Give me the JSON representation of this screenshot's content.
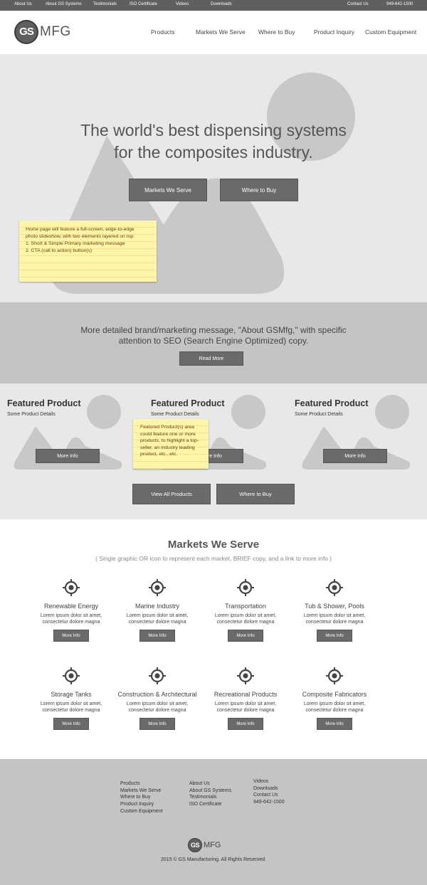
{
  "topbar": {
    "links": [
      "About Us",
      "About GS Systems",
      "Testimonials",
      "ISO Certificate",
      "Videos",
      "Downloads"
    ],
    "contact": "Contact Us",
    "phone": "949-642-1500"
  },
  "header": {
    "logo_mark": "GS",
    "logo_text": "MFG",
    "nav": [
      "Products",
      "Markets We Serve",
      "Where to Buy",
      "Product Inquiry",
      "Custom Equipment"
    ]
  },
  "hero": {
    "title_line1": "The world's best dispensing systems",
    "title_line2": "for the composites industry.",
    "cta_primary": "Markets We Serve",
    "cta_secondary": "Where to Buy",
    "note": [
      "Home page will feature a full-screen, edge-to-edge",
      "photo slideshow, with two elements layered on top:",
      "1. Short & Simple Primary marketing message",
      "2. CTA (call to action) button(s)"
    ]
  },
  "brand": {
    "line1": "More detailed brand/marketing message, \"About GSMfg,\" with specific",
    "line2": "attention to SEO (Search Engine Optimized) copy.",
    "button": "Read More"
  },
  "featured": {
    "items": [
      {
        "title": "Featured Product",
        "details": "Some Product Details",
        "button": "More Info"
      },
      {
        "title": "Featured Product",
        "details": "Some Product Details",
        "button": "More Info"
      },
      {
        "title": "Featured Product",
        "details": "Some Product Details",
        "button": "More Info"
      }
    ],
    "note": [
      "Featured Product(s) area",
      "could feature one or more",
      "products, to highlight a top-",
      "seller, an industry leading",
      "product, etc., etc."
    ],
    "view_all": "View All Products",
    "where_to_buy": "Where to Buy"
  },
  "markets": {
    "title": "Markets We Serve",
    "subtitle": "( Single graphic OR icon to represent each market, BRIEF copy, and a link to more info )",
    "items": [
      {
        "name": "Renewable Energy",
        "desc1": "Lorem ipsum dolor sit amet,",
        "desc2": "consectetur dolore magna",
        "button": "More Info",
        "icon": "crosshair-icon"
      },
      {
        "name": "Marine Industry",
        "desc1": "Lorem ipsum dolor sit amet,",
        "desc2": "consectetur dolore magna",
        "button": "More Info",
        "icon": "crosshair-icon"
      },
      {
        "name": "Transportation",
        "desc1": "Lorem ipsum dolor sit amet,",
        "desc2": "consectetur dolore magna",
        "button": "More Info",
        "icon": "crosshair-icon"
      },
      {
        "name": "Tub & Shower, Pools",
        "desc1": "Lorem ipsum dolor sit amet,",
        "desc2": "consectetur dolore magna",
        "button": "More Info",
        "icon": "crosshair-icon"
      },
      {
        "name": "Storage Tanks",
        "desc1": "Lorem ipsum dolor sit amet,",
        "desc2": "consectetur dolore magna",
        "button": "More Info",
        "icon": "crosshair-icon"
      },
      {
        "name": "Construction & Architectural",
        "desc1": "Lorem ipsum dolor sit amet,",
        "desc2": "consectetur dolore magna",
        "button": "More Info",
        "icon": "crosshair-icon"
      },
      {
        "name": "Recreational Products",
        "desc1": "Lorem ipsum dolor sit amet,",
        "desc2": "consectetur dolore magna",
        "button": "More Info",
        "icon": "crosshair-icon"
      },
      {
        "name": "Composite Fabricators",
        "desc1": "Lorem ipsum dolor sit amet,",
        "desc2": "consectetur dolore magna",
        "button": "More Info",
        "icon": "crosshair-icon"
      }
    ]
  },
  "footer": {
    "col1": [
      "Products",
      "Markets We Serve",
      "Where to Buy",
      "Product Inquiry",
      "Custom Equipment"
    ],
    "col2": [
      "About Us",
      "About GS Systems",
      "Testimonials",
      "ISO Certificate"
    ],
    "col3": [
      "Videos",
      "Downloads",
      "Contact Us",
      "949-642-1500"
    ],
    "logo_mark": "GS",
    "logo_text": "MFG",
    "copyright": "2015 © GS Manufacturing. All Rights Reserved."
  },
  "colors": {
    "button": "#6a6a6a",
    "topbar": "#5f5f5f",
    "section_light": "#e8e8e8",
    "section_mid": "#c4c4c4",
    "sticky_note": "#fdf5a8"
  }
}
